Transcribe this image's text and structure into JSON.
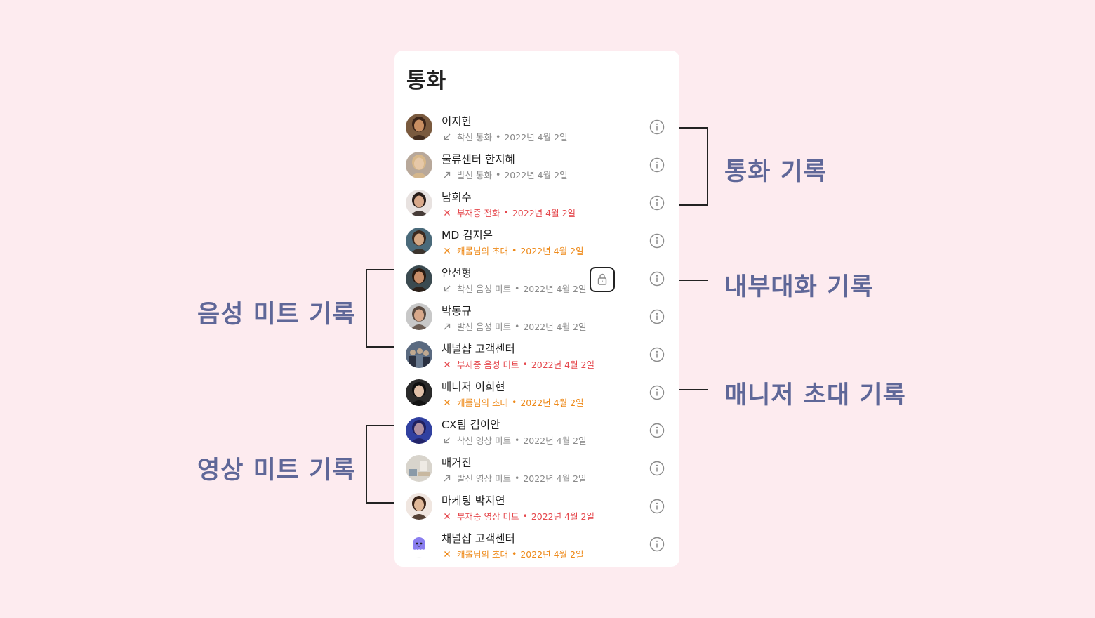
{
  "panel": {
    "title": "통화"
  },
  "calls": [
    {
      "name": "이지현",
      "direction": "incoming",
      "type": "착신 통화",
      "date": "2022년 4월 2일",
      "status": "normal",
      "avatar": "woman-dark-hair"
    },
    {
      "name": "물류센터 한지혜",
      "direction": "outgoing",
      "type": "발신 통화",
      "date": "2022년 4월 2일",
      "status": "normal",
      "avatar": "woman-blonde"
    },
    {
      "name": "남희수",
      "direction": "missed",
      "type": "부재중 전화",
      "date": "2022년 4월 2일",
      "status": "missed",
      "avatar": "man-smiling"
    },
    {
      "name": "MD 김지은",
      "direction": "invite",
      "type": "캐롤님의 초대",
      "date": "2022년 4월 2일",
      "status": "invite",
      "avatar": "woman-yellow"
    },
    {
      "name": "안선형",
      "direction": "incoming",
      "type": "착신 음성 미트",
      "date": "2022년 4월 2일",
      "status": "normal",
      "avatar": "man-dark"
    },
    {
      "name": "박동규",
      "direction": "outgoing",
      "type": "발신 음성 미트",
      "date": "2022년 4월 2일",
      "status": "normal",
      "avatar": "man-grey"
    },
    {
      "name": "채널샵 고객센터",
      "direction": "missed",
      "type": "부재중 음성 미트",
      "date": "2022년 4월 2일",
      "status": "missed",
      "avatar": "group-photo"
    },
    {
      "name": "매니저 이희현",
      "direction": "invite",
      "type": "캐롤님의 초대",
      "date": "2022년 4월 2일",
      "status": "invite",
      "avatar": "woman-black-hair"
    },
    {
      "name": "CX팀 김이안",
      "direction": "incoming",
      "type": "착신 영상 미트",
      "date": "2022년 4월 2일",
      "status": "normal",
      "avatar": "person-blue"
    },
    {
      "name": "매거진",
      "direction": "outgoing",
      "type": "발신 영상 미트",
      "date": "2022년 4월 2일",
      "status": "normal",
      "avatar": "room-interior"
    },
    {
      "name": "마케팅 박지연",
      "direction": "missed",
      "type": "부재중 영상 미트",
      "date": "2022년 4월 2일",
      "status": "missed",
      "avatar": "woman-smiling"
    },
    {
      "name": "채널샵 고객센터",
      "direction": "invite",
      "type": "캐롤님의 초대",
      "date": "2022년 4월 2일",
      "status": "invite",
      "avatar": "channel-bot"
    }
  ],
  "icons": {
    "info": "info-icon",
    "lock": "lock-icon",
    "incoming": "arrow-down-left-icon",
    "outgoing": "arrow-up-right-icon",
    "missed": "x-icon"
  },
  "colors": {
    "background": "#fdebef",
    "annotation": "#5f6798",
    "missed": "#e5484d",
    "invite": "#ee8a1a",
    "muted": "#8a8a8a"
  },
  "annotations": {
    "call_log": "통화 기록",
    "internal_chat_log": "내부대화 기록",
    "manager_invite_log": "매니저 초대 기록",
    "voice_meet_log": "음성 미트 기록",
    "video_meet_log": "영상 미트 기록"
  }
}
